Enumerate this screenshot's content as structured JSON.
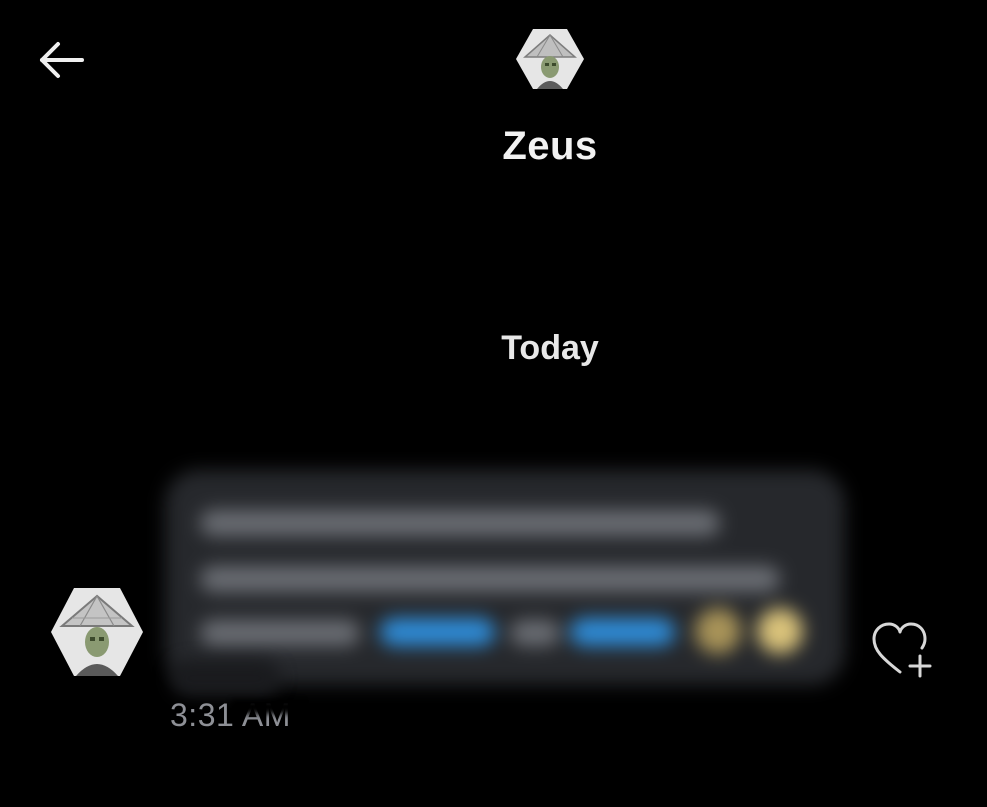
{
  "header": {
    "back_icon": "arrow-left-icon",
    "contact_name": "Zeus",
    "avatar_icon": "avatar-image"
  },
  "conversation": {
    "date_separator": "Today",
    "messages": [
      {
        "sender": "Zeus",
        "text_blurred": true,
        "timestamp": "3:31 AM",
        "like_icon": "heart-plus-icon"
      }
    ]
  },
  "colors": {
    "background": "#000000",
    "bubble": "#26282c",
    "timestamp": "#8e9096",
    "link": "#2e8bd6"
  }
}
